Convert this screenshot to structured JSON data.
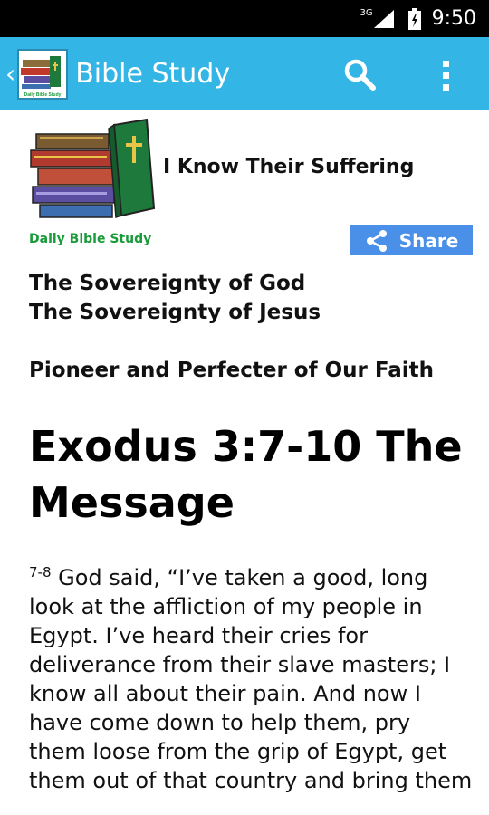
{
  "status_bar": {
    "network": "3G",
    "time": "9:50"
  },
  "app_bar": {
    "title": "Bible Study",
    "logo_caption": "Daily Bible Study",
    "icons": [
      "back-chevron-icon",
      "app-logo-icon",
      "search-icon",
      "overflow-menu-icon"
    ]
  },
  "article": {
    "heading": "I Know Their Suffering",
    "brand_caption": "Daily Bible Study",
    "share_label": "Share",
    "links": [
      "The Sovereignty of God",
      "The Sovereignty of Jesus",
      "Pioneer and Perfecter of Our Faith"
    ],
    "scripture_title": "Exodus 3:7-10  The Message",
    "verse_number": "7-8",
    "passage_text": " God said, “I’ve taken a good, long look at the affliction of my people in Egypt. I’ve heard their cries for deliverance from their slave masters; I know all about their pain. And now I have come down to help them, pry them loose from the grip of Egypt, get them out of that country and bring them"
  },
  "colors": {
    "status_bar": "#000000",
    "app_bar": "#33b5e5",
    "share_button": "#4a90e8",
    "brand_green": "#1a9b3a"
  }
}
